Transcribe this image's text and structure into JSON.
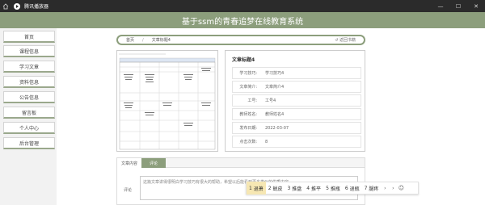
{
  "window": {
    "title": "腾讯播放器"
  },
  "site": {
    "title": "基于ssm的青春追梦在线教育系统"
  },
  "sidebar": {
    "items": [
      "首页",
      "课程信息",
      "学习文章",
      "资料信息",
      "公告信息",
      "留言板",
      "个人中心",
      "后台管理"
    ]
  },
  "breadcrumb": {
    "home": "首页",
    "separator": "/",
    "current": "文章标题4",
    "back": "↺ 返回书籍"
  },
  "detail": {
    "title": "文章标题4",
    "rows": [
      {
        "label": "学习技巧:",
        "value": "学习技巧4"
      },
      {
        "label": "文章简介:",
        "value": "文章简介4"
      },
      {
        "label": "工号:",
        "value": "工号4"
      },
      {
        "label": "教师姓名:",
        "value": "教师姓名4"
      },
      {
        "label": "发布日期:",
        "value": "2022-03-07"
      },
      {
        "label": "点击次数:",
        "value": "8"
      }
    ]
  },
  "tabs": {
    "content": "文章内容",
    "comment": "评论"
  },
  "comment": {
    "label": "评论",
    "text": "这篇文章讲得很明白学习技巧有很大的帮助，希望以后能看到更多类似的优质内容"
  },
  "ime": {
    "candidates": [
      {
        "num": "1",
        "text": "退萧"
      },
      {
        "num": "2",
        "text": "蜕皮"
      },
      {
        "num": "3",
        "text": "推盘"
      },
      {
        "num": "4",
        "text": "推平"
      },
      {
        "num": "5",
        "text": "推瓶"
      },
      {
        "num": "6",
        "text": "退瓶"
      },
      {
        "num": "7",
        "text": "腿疼"
      }
    ]
  },
  "colors": {
    "accent": "#8c9e7c",
    "titlebar": "#2b2b2b",
    "ime_highlight": "#f6e7b3"
  }
}
